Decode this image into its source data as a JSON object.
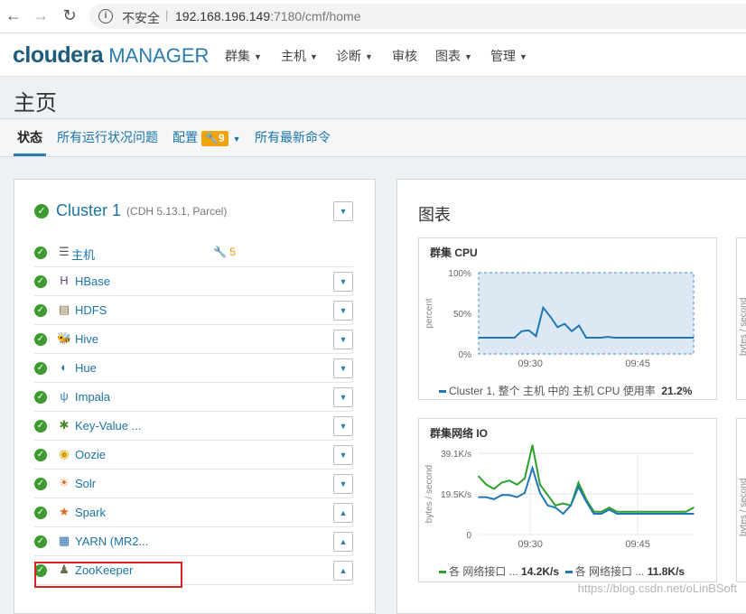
{
  "browser": {
    "insecure_label": "不安全",
    "url_host": "192.168.196.149",
    "url_rest": ":7180/cmf/home"
  },
  "header": {
    "logo_main": "cloudera",
    "logo_sub": "MANAGER",
    "menus": [
      "群集",
      "主机",
      "诊断",
      "审核",
      "图表",
      "管理"
    ]
  },
  "page": {
    "title": "主页",
    "tabs": [
      "状态",
      "所有运行状况问题",
      "配置",
      "所有最新命令"
    ],
    "config_badge": "9"
  },
  "cluster": {
    "name": "Cluster 1",
    "meta": "(CDH 5.13.1, Parcel)",
    "hosts_label": "主机",
    "hosts_warn": "5",
    "services": [
      {
        "name": "HBase",
        "icon": "hbase-icon"
      },
      {
        "name": "HDFS",
        "icon": "hdfs-icon"
      },
      {
        "name": "Hive",
        "icon": "hive-icon"
      },
      {
        "name": "Hue",
        "icon": "hue-icon"
      },
      {
        "name": "Impala",
        "icon": "impala-icon"
      },
      {
        "name": "Key-Value ...",
        "icon": "key-value-icon"
      },
      {
        "name": "Oozie",
        "icon": "oozie-icon"
      },
      {
        "name": "Solr",
        "icon": "solr-icon"
      },
      {
        "name": "Spark",
        "icon": "spark-icon"
      },
      {
        "name": "YARN (MR2...",
        "icon": "yarn-icon"
      },
      {
        "name": "ZooKeeper",
        "icon": "zookeeper-icon"
      }
    ]
  },
  "charts": {
    "heading": "图表",
    "side_ylabel": "bytes / second",
    "cpu": {
      "title": "群集 CPU",
      "legend_label": "Cluster 1, 整个 主机 中的 主机 CPU 使用率",
      "legend_value": "21.2%"
    },
    "net": {
      "title": "群集网络 IO",
      "legend1_label": "各 网络接口 ...",
      "legend1_value": "14.2K/s",
      "legend2_label": "各 网络接口 ...",
      "legend2_value": "11.8K/s"
    }
  },
  "chart_data": [
    {
      "type": "area",
      "title": "群集 CPU",
      "ylabel": "percent",
      "yticks": [
        "100%",
        "50%",
        "0%"
      ],
      "ylim": [
        0,
        100
      ],
      "xticks": [
        "09:30",
        "09:45"
      ],
      "series": [
        {
          "name": "Cluster 1, 整个 主机 中的 主机 CPU 使用率",
          "color": "#1f77b4",
          "values": [
            20,
            20,
            20,
            20,
            20,
            20,
            28,
            29,
            22,
            57,
            46,
            33,
            37,
            28,
            35,
            20,
            20,
            20,
            21,
            20,
            20,
            20,
            20,
            20,
            20,
            20,
            20,
            20,
            20,
            20,
            20
          ]
        }
      ]
    },
    {
      "type": "line",
      "title": "群集网络 IO",
      "ylabel": "bytes / second",
      "yticks": [
        "39.1K/s",
        "19.5K/s",
        "0"
      ],
      "ylim": [
        0,
        39.1
      ],
      "xticks": [
        "09:30",
        "09:45"
      ],
      "series": [
        {
          "name": "各 网络接口 ...",
          "color": "#2ca02c",
          "values": [
            28,
            24,
            22,
            25,
            26,
            24,
            27,
            43,
            24,
            19,
            14,
            15,
            14,
            25,
            17,
            11,
            11,
            13,
            11,
            11,
            11,
            11,
            11,
            11,
            11,
            11,
            11,
            11,
            13
          ]
        },
        {
          "name": "各 网络接口 ...",
          "color": "#1f77b4",
          "values": [
            18,
            18,
            17,
            19,
            19,
            18,
            20,
            32,
            20,
            14,
            13,
            10,
            14,
            23,
            16,
            10,
            10,
            12,
            10,
            10,
            10,
            10,
            10,
            10,
            10,
            10,
            10,
            10,
            10
          ]
        }
      ]
    }
  ]
}
